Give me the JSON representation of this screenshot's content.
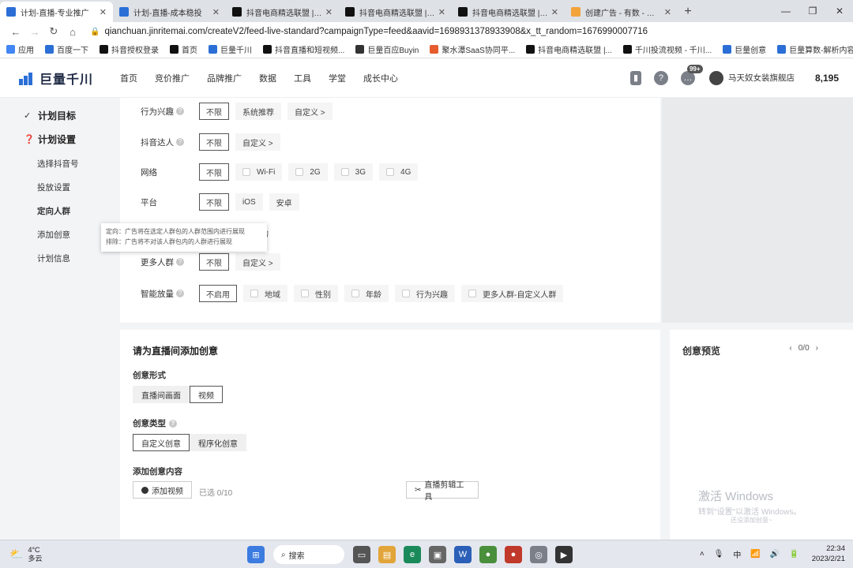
{
  "browser": {
    "tabs": [
      {
        "title": "计划-直播-专业推广",
        "active": true,
        "favicon_color": "#2b6fd6"
      },
      {
        "title": "计划-直播-成本稳投",
        "active": false,
        "favicon_color": "#2b6fd6"
      },
      {
        "title": "抖音电商精选联盟 | 商家",
        "active": false,
        "favicon_color": "#111111"
      },
      {
        "title": "抖音电商精选联盟 | 商家",
        "active": false,
        "favicon_color": "#111111"
      },
      {
        "title": "抖音电商精选联盟 | 商家",
        "active": false,
        "favicon_color": "#111111"
      },
      {
        "title": "创建广告 - 有数 - 有米云",
        "active": false,
        "favicon_color": "#f2a33a"
      }
    ],
    "new_tab": "+",
    "url": "qianchuan.jinritemai.com/createV2/feed-live-standard?campaignType=feed&aavid=1698931378933908&x_tt_random=1676990007716",
    "bookmarks": [
      {
        "label": "应用",
        "color": "#4285f4"
      },
      {
        "label": "百度一下",
        "color": "#2b6fd6"
      },
      {
        "label": "抖音授权登录",
        "color": "#111111"
      },
      {
        "label": "首页",
        "color": "#111111"
      },
      {
        "label": "巨量千川",
        "color": "#2b6fd6"
      },
      {
        "label": "抖音直播和短视频...",
        "color": "#111111"
      },
      {
        "label": "巨量百应Buyin",
        "color": "#333333"
      },
      {
        "label": "聚水潭SaaS协同平...",
        "color": "#e65c2e"
      },
      {
        "label": "抖音电商精选联盟 |...",
        "color": "#111111"
      },
      {
        "label": "千川投流视频 - 千川...",
        "color": "#111111"
      },
      {
        "label": "巨量创意",
        "color": "#2b6fd6"
      },
      {
        "label": "巨量算数-解析内容",
        "color": "#2b6fd6"
      }
    ]
  },
  "header": {
    "logo": "巨量千川",
    "nav": [
      "首页",
      "竞价推广",
      "品牌推广",
      "数据",
      "工具",
      "学堂",
      "成长中心"
    ],
    "notification_badge": "99+",
    "shop_name": "马天奴女装旗舰店",
    "balance": "8,195"
  },
  "sidebar": {
    "steps": [
      {
        "label": "计划目标",
        "icon": "check-icon",
        "glyph": "✓"
      },
      {
        "label": "计划设置",
        "icon": "question-icon",
        "glyph": "❓"
      }
    ],
    "items": [
      "选择抖音号",
      "投放设置",
      "定向人群",
      "添加创意",
      "计划信息"
    ],
    "current": "定向人群"
  },
  "targeting": {
    "rows": [
      {
        "label": "行为兴趣",
        "help": true,
        "options": [
          "不限",
          "系统推荐",
          "自定义 >"
        ],
        "selected": 0,
        "checkbox": false
      },
      {
        "label": "抖音达人",
        "help": true,
        "options": [
          "不限",
          "自定义 >"
        ],
        "selected": 0,
        "checkbox": false
      },
      {
        "label": "网络",
        "help": false,
        "options": [
          "不限",
          "Wi-Fi",
          "2G",
          "3G",
          "4G"
        ],
        "selected": 0,
        "checkbox": true
      },
      {
        "label": "平台",
        "help": false,
        "options": [
          "不限",
          "iOS",
          "安卓"
        ],
        "selected": 0,
        "checkbox": false
      },
      {
        "label": "更多人群",
        "help": true,
        "options": [
          "不限",
          "自定义 >"
        ],
        "selected": 0,
        "checkbox": false
      },
      {
        "label": "智能放量",
        "help": true,
        "options": [
          "不启用",
          "地域",
          "性别",
          "年龄",
          "行为兴趣",
          "更多人群-自定义人群"
        ],
        "selected": 0,
        "checkbox": true
      }
    ],
    "tooltip_lines": [
      "定向：广告将在选定人群包的人群范围内进行展现",
      "排除：广告将不对该人群包内的人群进行展现"
    ],
    "tooltip_tail": "购"
  },
  "creative": {
    "title": "请为直播间添加创意",
    "form_label": "创意形式",
    "form_options": [
      "直播间画面",
      "视频"
    ],
    "form_selected": 1,
    "type_label": "创意类型",
    "type_options": [
      "自定义创意",
      "程序化创意"
    ],
    "type_selected": 0,
    "content_label": "添加创意内容",
    "add_video": "添加视频",
    "selected_count": "已选 0/10",
    "edit_tool": "直播剪辑工具"
  },
  "preview": {
    "title": "创意预览",
    "counter": "0/0"
  },
  "watermark": {
    "line1": "激活 Windows",
    "line2": "转到\"设置\"以激活 Windows。",
    "line3": "还没添加创意~"
  },
  "taskbar": {
    "temp": "4°C",
    "weather": "多云",
    "search": "搜索",
    "ime": "中",
    "time": "22:34",
    "date": "2023/2/21"
  }
}
